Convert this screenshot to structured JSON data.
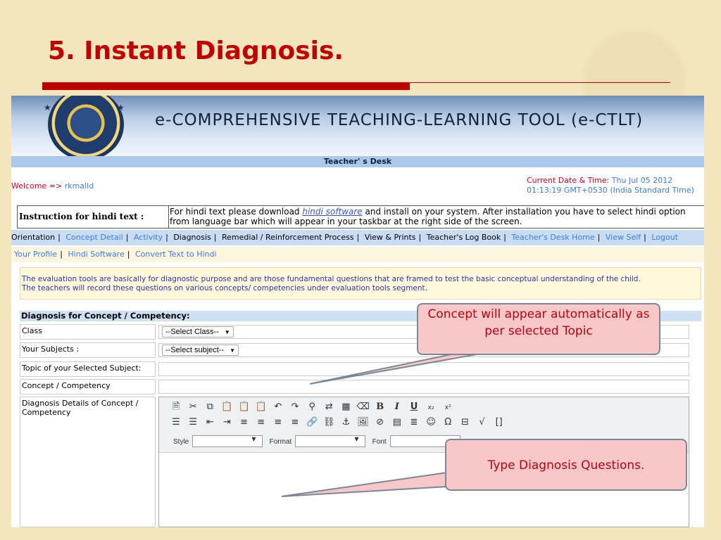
{
  "slide": {
    "title": "5. Instant Diagnosis."
  },
  "banner": {
    "title": "e-COMPREHENSIVE TEACHING-LEARNING TOOL (e-CTLT)",
    "subtitle": "Teacher' s Desk"
  },
  "welcome": {
    "label": "Welcome => ",
    "user": "rkmalld"
  },
  "datetime": {
    "label": "Current Date & Time: ",
    "value_line1": "Thu Jul 05 2012",
    "value_line2": "01:13:19 GMT+0530 (India Standard Time)"
  },
  "instruction": {
    "label": "Instruction for hindi text :",
    "text_before": "For hindi text please download ",
    "link": "hindi software",
    "text_after": " and install on your system. After installation you have to select hindi option from language bar which will appear in your taskbar at the right side of the screen."
  },
  "nav": {
    "items": [
      {
        "label": "Orientation",
        "active": false
      },
      {
        "label": "Concept Detail",
        "active": true
      },
      {
        "label": "Activity",
        "active": true
      },
      {
        "label": "Diagnosis",
        "active": false
      },
      {
        "label": "Remedial / Reinforcement Process",
        "active": false
      },
      {
        "label": "View & Prints",
        "active": false
      },
      {
        "label": "Teacher's Log Book",
        "active": false
      },
      {
        "label": "Teacher's Desk Home",
        "active": true
      },
      {
        "label": "View Self",
        "active": true
      },
      {
        "label": "Logout",
        "active": true
      }
    ],
    "secondary": [
      "Your Profile",
      "Hindi Software",
      "Convert Text to Hindi"
    ]
  },
  "info": {
    "line1": "The evaluation tools are basically for diagnostic purpose and are those fundamental questions that are framed to test the basic conceptual understanding of the child.",
    "line2": "The teachers will record these questions on various concepts/ competencies under evaluation tools segment."
  },
  "form": {
    "heading": "Diagnosis for Concept / Competency:",
    "class_label": "Class",
    "class_value": "--Select Class--",
    "subjects_label": "Your Subjects :",
    "subjects_value": "--Select subject--",
    "topic_label": "Topic of your Selected Subject:",
    "concept_label": "Concept / Competency",
    "details_label": "Diagnosis Details of Concept / Competency"
  },
  "editor": {
    "style_label": "Style",
    "format_label": "Format",
    "font_label": "Font"
  },
  "callouts": {
    "concept": "Concept will appear automatically as per selected Topic",
    "diagnosis": "Type Diagnosis Questions."
  },
  "colors": {
    "title_red": "#c00000",
    "link_blue": "#3b7dd8",
    "callout_fill": "#f8c8c8",
    "callout_text": "#b8000f"
  }
}
